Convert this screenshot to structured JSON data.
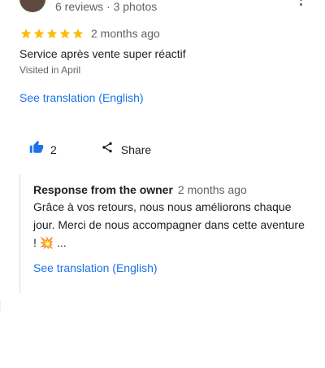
{
  "review": {
    "reviewer_meta": "6 reviews · 3 photos",
    "rating": 5,
    "date": "2 months ago",
    "text": "Service après vente super réactif",
    "visited": "Visited in April",
    "see_translation": "See translation (English)"
  },
  "actions": {
    "like_count": "2",
    "share_label": "Share"
  },
  "owner_response": {
    "title": "Response from the owner",
    "date": "2 months ago",
    "text": "Grâce à vos retours, nous nous améliorons chaque jour. Merci de nous accompagner dans cette aventure ! 💥 ...",
    "see_translation": "See translation (English)"
  },
  "colors": {
    "star": "#fbbc04",
    "link": "#1a73e8",
    "like_icon": "#1a73e8"
  }
}
